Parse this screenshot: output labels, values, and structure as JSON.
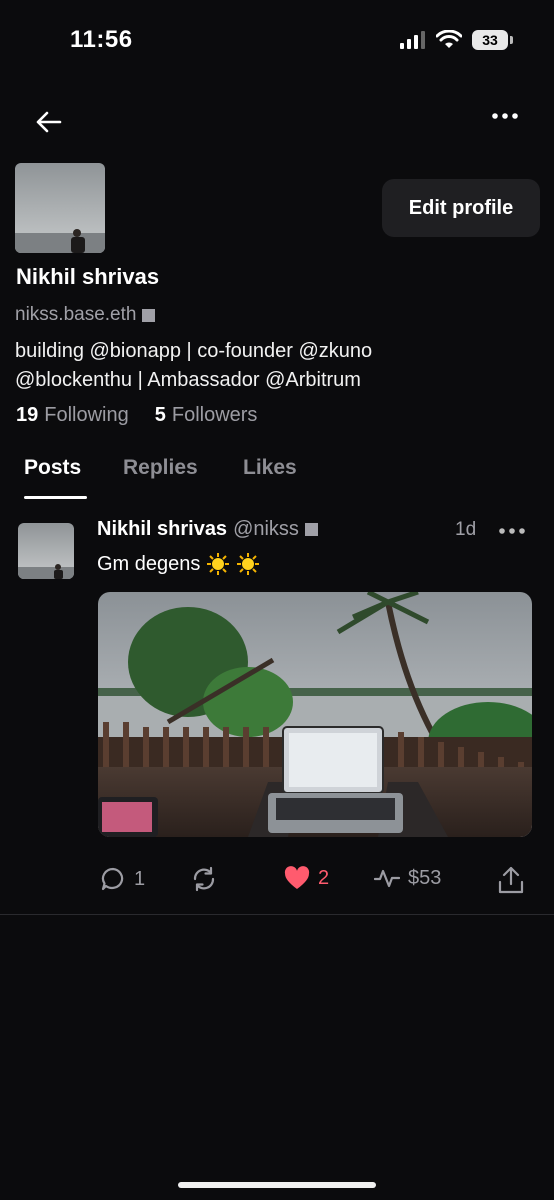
{
  "status_bar": {
    "time": "11:56",
    "battery": "33"
  },
  "header": {
    "back_icon": "arrow-left-icon",
    "more_icon": "more-horizontal-icon"
  },
  "profile": {
    "edit_label": "Edit profile",
    "name": "Nikhil shrivas",
    "handle": "nikss.base.eth",
    "bio_line1": "building @bionapp | co-founder @zkuno",
    "bio_line2": "@blockenthu | Ambassador @Arbitrum",
    "following_count": "19",
    "following_label": "Following",
    "followers_count": "5",
    "followers_label": "Followers"
  },
  "tabs": [
    {
      "label": "Posts",
      "active": true
    },
    {
      "label": "Replies",
      "active": false
    },
    {
      "label": "Likes",
      "active": false
    }
  ],
  "post": {
    "author": "Nikhil shrivas",
    "handle": "@nikss",
    "time": "1d",
    "text": "Gm degens",
    "reply_count": "1",
    "like_count": "2",
    "tip_amount": "$53"
  },
  "colors": {
    "accent_like": "#ff5b6e",
    "background": "#0b0b0d",
    "muted": "#9c9ca3"
  }
}
